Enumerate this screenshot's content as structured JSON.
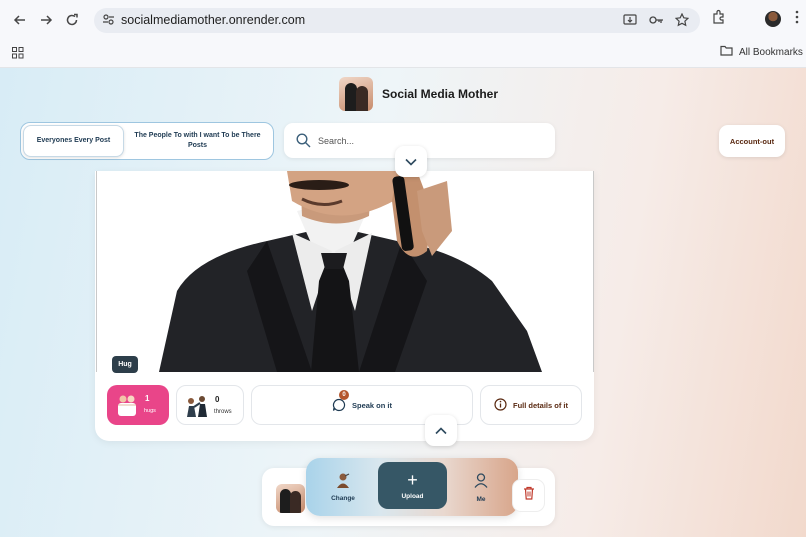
{
  "browser": {
    "url": "socialmediamother.onrender.com",
    "bookmarks_label": "All Bookmarks",
    "icons": [
      "back-arrow-icon",
      "forward-arrow-icon",
      "reload-icon",
      "site-settings-icon",
      "install-app-icon",
      "password-key-icon",
      "bookmark-star-icon",
      "extensions-icon",
      "profile-avatar",
      "kebab-menu-icon",
      "apps-grid-icon",
      "folder-icon"
    ]
  },
  "header": {
    "title": "Social Media Mother"
  },
  "tabs": {
    "everyone": "Everyones Every Post",
    "people": "The People To with I want To be There Posts"
  },
  "search": {
    "placeholder": "Search..."
  },
  "account": {
    "label": "Account-out"
  },
  "post": {
    "tag": "Hug",
    "hugs_count": "1",
    "hugs_label": "hugs",
    "throws_count": "0",
    "throws_label": "throws",
    "speak_label": "Speak on it",
    "speak_badge": "0",
    "details_label": "Full details of it"
  },
  "dock": {
    "change_label": "Change",
    "upload_label": "Upload",
    "me_label": "Me"
  },
  "colors": {
    "hug_pink": "#e94589",
    "upload_teal": "#365766",
    "badge_brown": "#b4562d",
    "accent_navy": "#1e3a52"
  }
}
